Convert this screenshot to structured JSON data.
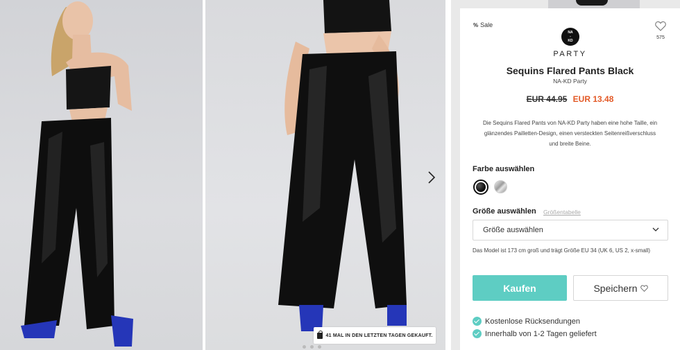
{
  "product": {
    "sale_tag": "Sale",
    "brand_logo_lines": [
      "NA",
      "-",
      "KD"
    ],
    "brand_word": "PARTY",
    "title": "Sequins Flared Pants Black",
    "subtitle": "NA-KD Party",
    "price_old": "EUR 44.95",
    "price_new": "EUR 13.48",
    "description": "Die Sequins Flared Pants von NA-KD Party haben eine hohe Taille, ein glänzendes Pailletten-Design, einen versteckten Seitenreißverschluss und breite Beine.",
    "wishlist_count": "575"
  },
  "color": {
    "label": "Farbe auswählen",
    "options": [
      {
        "name": "black",
        "hex": "#111111",
        "selected": true
      },
      {
        "name": "silver",
        "hex": "#b5b5b5",
        "selected": false
      }
    ]
  },
  "size": {
    "label": "Größe auswählen",
    "guide_link": "Größentabelle",
    "select_value": "Größe auswählen"
  },
  "model_note": "Das Model ist 173 cm groß und trägt Größe EU 34 (UK 6, US 2, x-small)",
  "actions": {
    "buy_label": "Kaufen",
    "save_label": "Speichern"
  },
  "benefits": [
    "Kostenlose Rücksendungen",
    "Innerhalb von 1-2 Tagen geliefert"
  ],
  "gallery": {
    "purchase_badge": "41 MAL IN DEN LETZTEN TAGEN GEKAUFT.",
    "dot_count": 3
  },
  "colors": {
    "accent": "#5ecdc3",
    "sale_price": "#e35926"
  }
}
